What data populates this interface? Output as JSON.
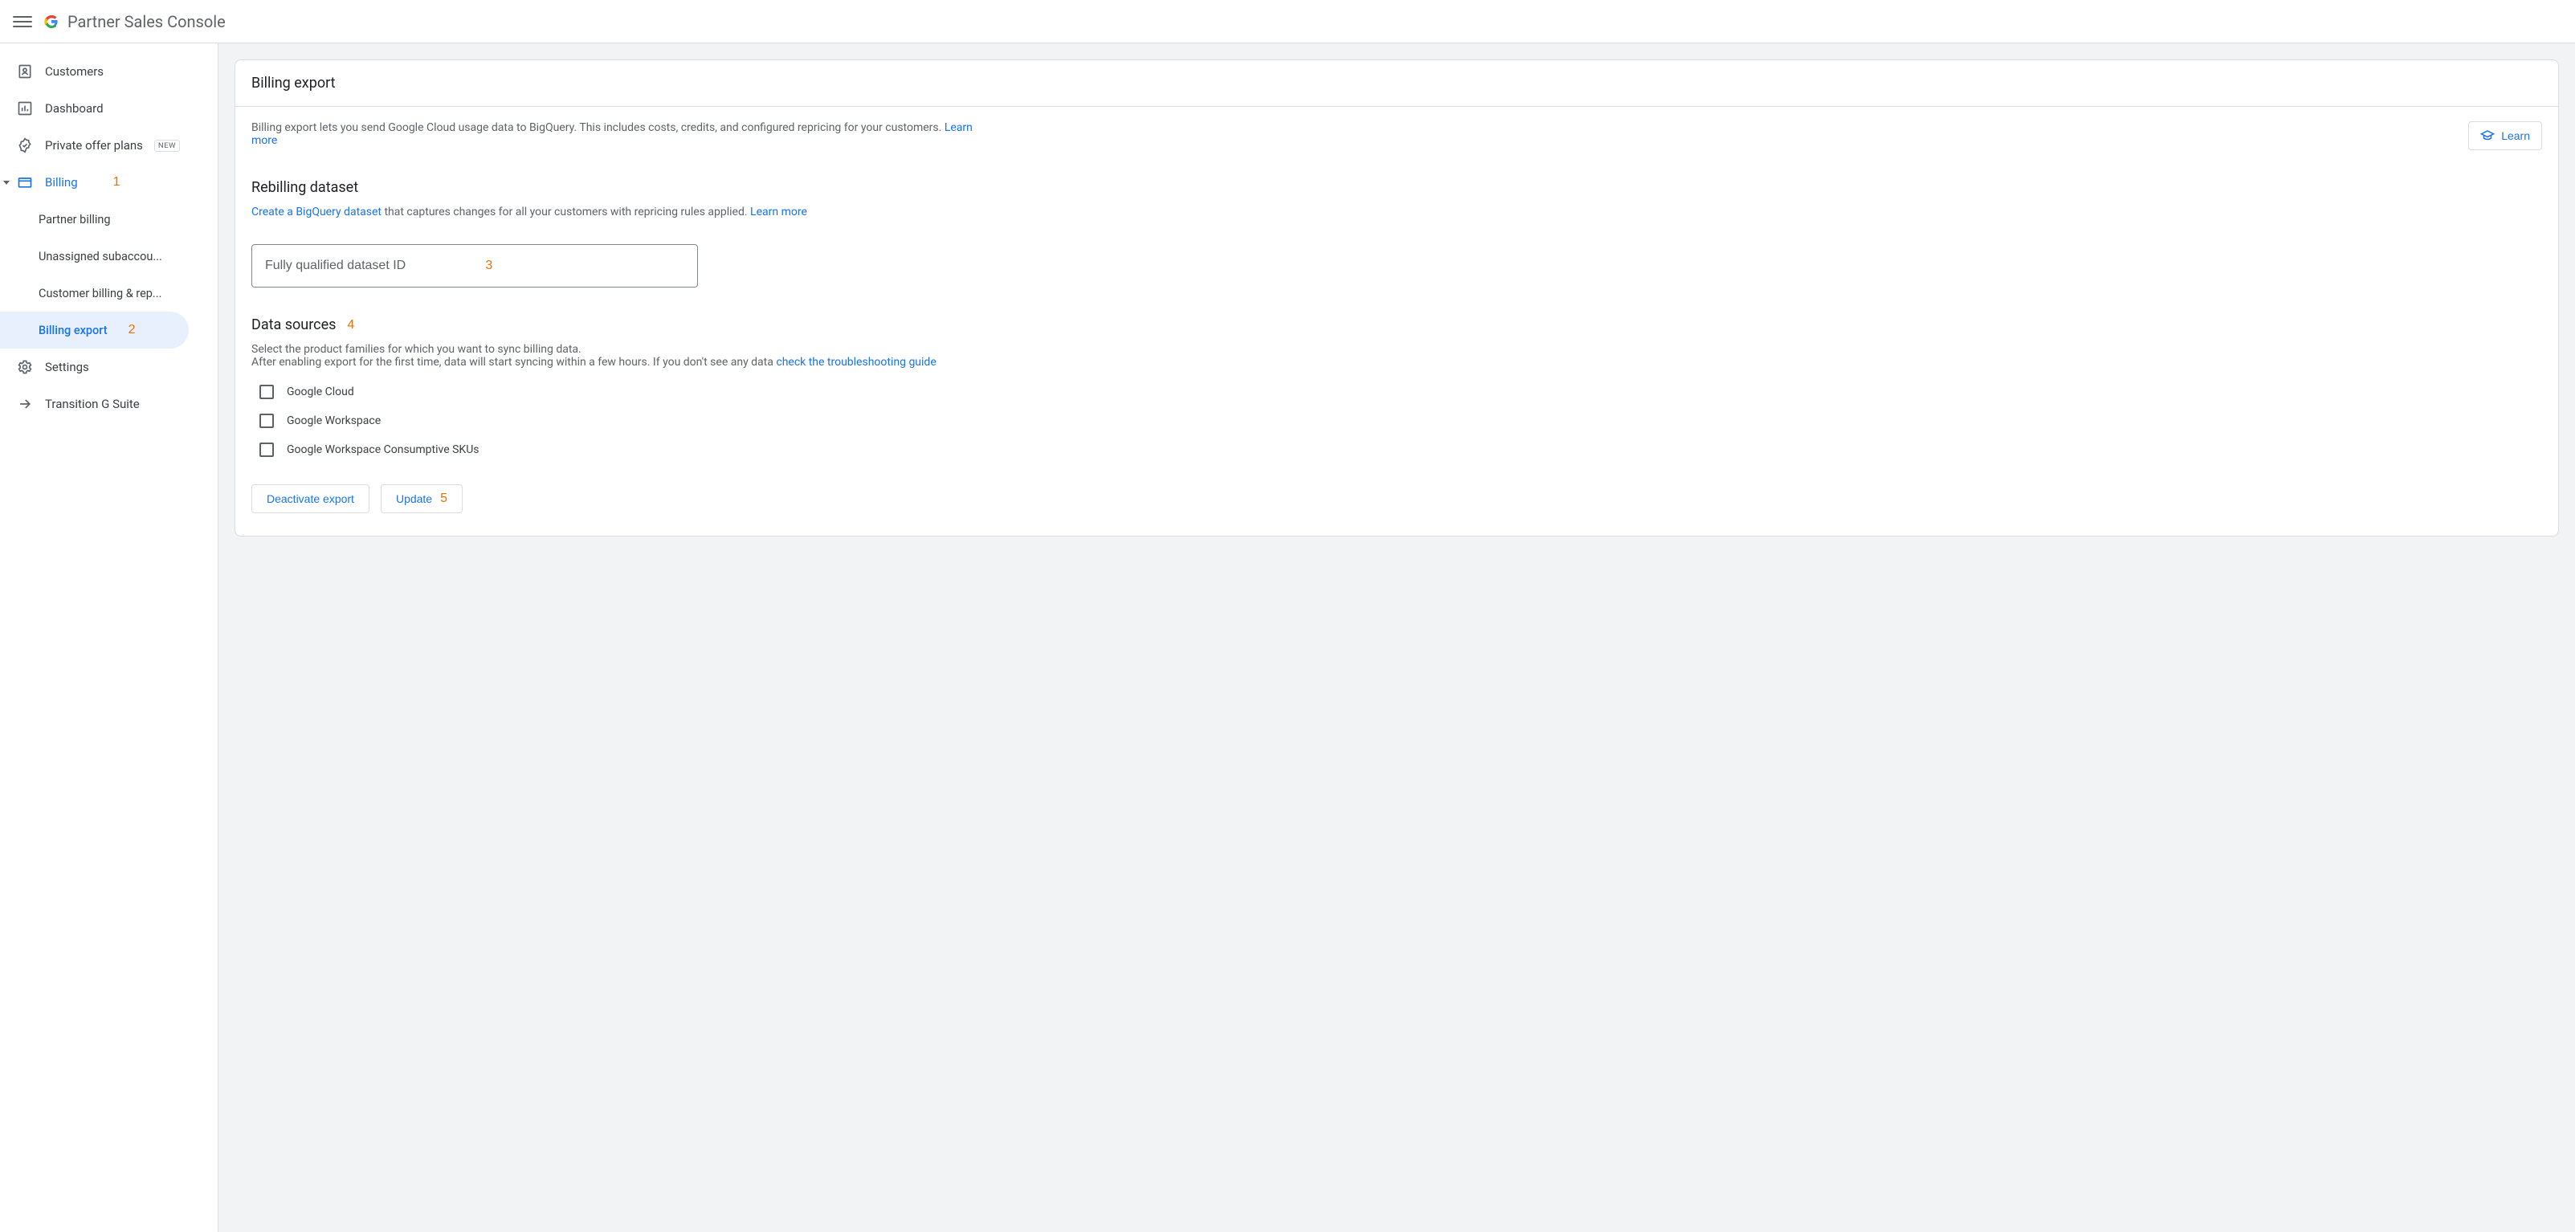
{
  "header": {
    "app_title": "Partner Sales Console"
  },
  "sidebar": {
    "items": [
      {
        "label": "Customers"
      },
      {
        "label": "Dashboard"
      },
      {
        "label": "Private offer plans",
        "badge": "NEW"
      },
      {
        "label": "Billing",
        "annotation": "1"
      },
      {
        "label": "Partner billing"
      },
      {
        "label": "Unassigned subaccou..."
      },
      {
        "label": "Customer billing & rep..."
      },
      {
        "label": "Billing export",
        "annotation": "2"
      },
      {
        "label": "Settings"
      },
      {
        "label": "Transition G Suite"
      }
    ]
  },
  "main": {
    "title": "Billing export",
    "description": "Billing export lets you send Google Cloud usage data to BigQuery. This includes costs, credits, and configured repricing for your customers. ",
    "learn_more": "Learn more",
    "learn_button": "Learn",
    "rebilling": {
      "heading": "Rebilling dataset",
      "link1": "Create a BigQuery dataset",
      "text_mid": " that captures changes for all your customers with repricing rules applied. ",
      "link2": "Learn more",
      "input_placeholder": "Fully qualified dataset ID",
      "input_annotation": "3"
    },
    "data_sources": {
      "heading": "Data sources",
      "annotation": "4",
      "line1": "Select the product families for which you want to sync billing data.",
      "line2_a": "After enabling export for the first time, data will start syncing within a few hours. If you don't see any data ",
      "line2_link": "check the troubleshooting guide",
      "options": [
        "Google Cloud",
        "Google Workspace",
        "Google Workspace Consumptive SKUs"
      ]
    },
    "buttons": {
      "deactivate": "Deactivate export",
      "update": "Update",
      "update_annotation": "5"
    }
  }
}
